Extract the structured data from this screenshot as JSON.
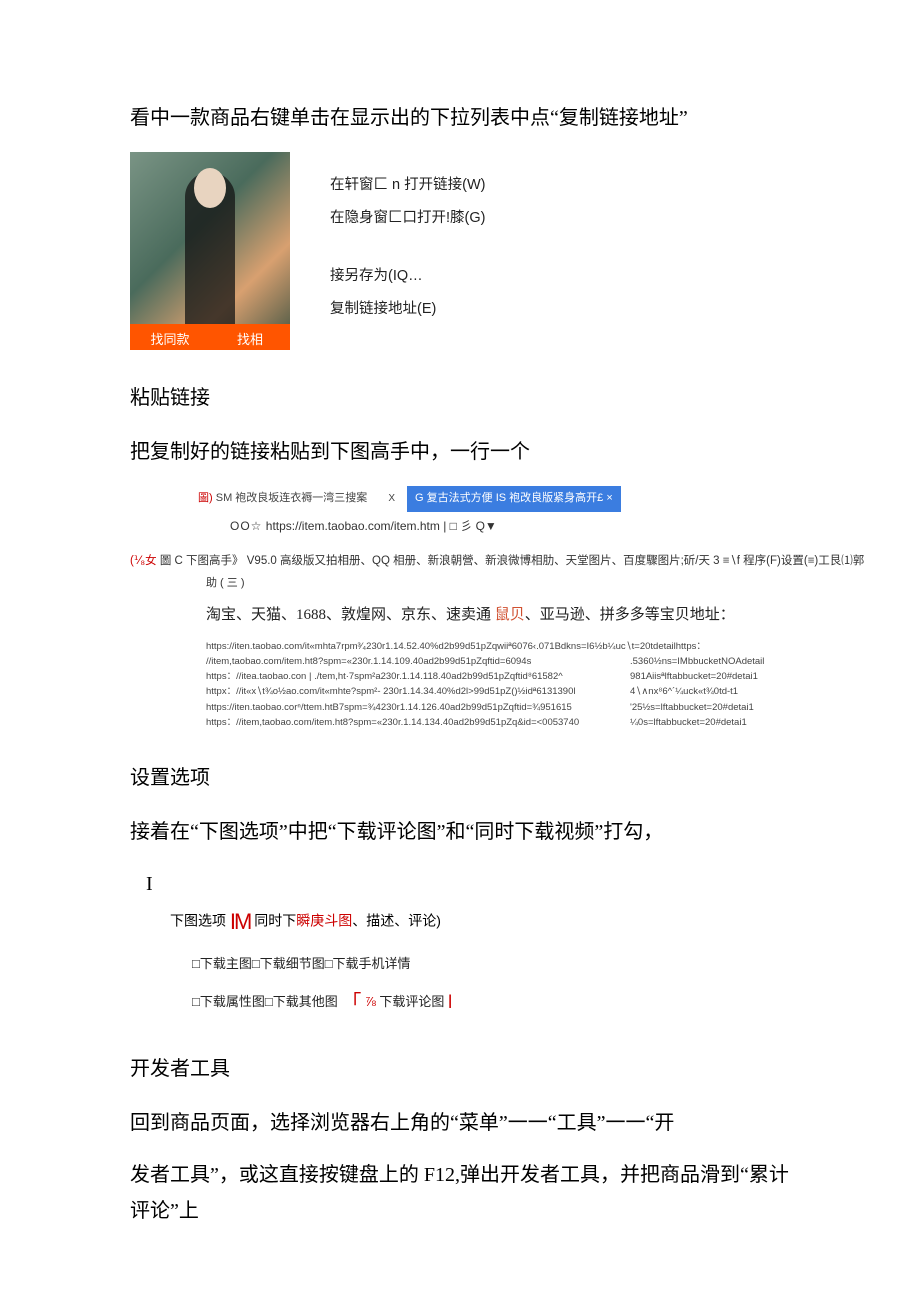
{
  "intro_text": "看中一款商品右键单击在显示出的下拉列表中点“复制链接地址”",
  "thumb": {
    "btn_left": "找同款",
    "btn_right": "找相"
  },
  "context_menu": {
    "open_new": "在轩窗匚 n 打开链接(W)",
    "open_incognito": "在隐身窗匚口打开!膝(G)",
    "save_as": "接另存为(IQ…",
    "copy_link": "复制链接地址(E)"
  },
  "section_paste": "粘贴链接",
  "paste_intro": "把复制好的链接粘贴到下图高手中，一行一个",
  "tabs": {
    "inactive_prefix": "圖)",
    "inactive_text": "SM 袍改良坂连衣褥一湾三搜案",
    "inactive_x": "X",
    "active_prefix": "G ",
    "active_text": "复古法式方便 IS 袍改良版紧身高开£ ×"
  },
  "address": {
    "prefix": "OO☆",
    "url": "https://item.taobao.com/item.htm",
    "suffix": " | □ 彡 Q▼"
  },
  "app_title": {
    "prefix": "(⅟₈女",
    "mid": "圖 C 下图高手》",
    "rest": "V95.0 高级版又拍相册、QQ 相册、新浪朝營、新浪微博相肋、天堂图片、百度驟图片;斫/天 3 ≡∖f 程序(F)设置(≡)工艮⑴郭"
  },
  "app_subline": "助 ( 三 )",
  "platform_line_pre": "淘宝、天猫、1688、敦煌网、京东、速卖通 ",
  "platform_line_red": "鼠贝",
  "platform_line_post": "、亚马逊、拼多多等宝贝地址：",
  "urls": [
    {
      "left": "https://iten.taobao.com/it«mhta7rpm³⁄₄230r1.14.52.40%d2b99d51pZqwiiª6076‹.071Bdkns=I6½b¼uc∖t=20tdetailhttps：",
      "right": ""
    },
    {
      "left": "//item,taobao.com/item.ht8?spm=«230r.1.14.109.40ad2b99d51pZqftid=6094s",
      "right": ".5360½ns=IMbbucketNOAdetail"
    },
    {
      "left": "https：//itea.taobao.con | ./tem,ht·7spm²a230r.1.14.118.40ad2b99d51pZqftid⁸61582^",
      "right": "981Aiisªlftabbucket=20#detai1"
    },
    {
      "left": "httpx：//it«x∖t¾o½ao.com/it«mhte?spm²- 230r1.14.34.40%d2l>99d51pZ()½idª6131390l",
      "right": "4∖∧nx⁸6^´¼uck«t¾0td-t1"
    },
    {
      "left": "https://iten.taobao.corⁿ/ttem.htB7spm=¾4230r1.14.126.40ad2b99d51pZqftid=¾951615",
      "right": "'25½s=lftabbucket=20#detai1"
    },
    {
      "left": "https：//item,taobao.com/item.ht8?spm=«230r.1.14.134.40ad2b99d51pZq&id=<0053740",
      "right": "¼0s=lftabbucket=20#detai1"
    }
  ],
  "section_options": "设置选项",
  "options_intro": "接着在“下图选项”中把“下载评论图”和“同时下载视频”打勾，",
  "options_row_pre": "下图选项 ",
  "options_row_im": "IM",
  "options_row_mid": " 同时下",
  "options_row_red": "瞬庚斗图",
  "options_row_post": "、描述、评论)",
  "checkbox_row1": "□下载主图□下载细节图□下载手机详情",
  "checkbox_row2_pre": "□下载属性图□下载其他图  ",
  "checkbox_row2_bracket": "「",
  "checkbox_row2_frac": "⅞",
  "checkbox_row2_label": "下载评论图",
  "checkbox_row2_bar": "l",
  "section_devtools": "开发者工具",
  "devtools_p1_a": "回到商品页面，选择浏览器右上角的“菜单”一一“工具”一一“开",
  "devtools_p1_b": "发者工具”，或这直接按键盘上的 F12,弹出开发者工具，并把商品滑到“累计评论”上"
}
